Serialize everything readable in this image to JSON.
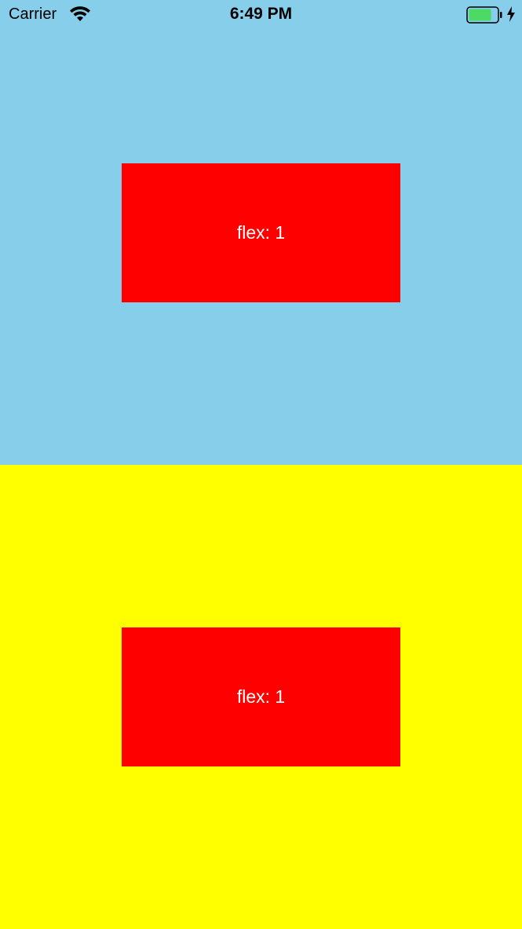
{
  "status_bar": {
    "carrier": "Carrier",
    "time": "6:49 PM",
    "icons": [
      "wifi-icon",
      "battery-icon",
      "charging-bolt-icon"
    ],
    "battery_level": 0.8
  },
  "sections": [
    {
      "background": "#87CEEB",
      "box": {
        "label": "flex: 1",
        "color": "#FF0000",
        "text_color": "#FFFFFF"
      }
    },
    {
      "background": "#FFFF00",
      "box": {
        "label": "flex: 1",
        "color": "#FF0000",
        "text_color": "#FFFFFF"
      }
    }
  ]
}
